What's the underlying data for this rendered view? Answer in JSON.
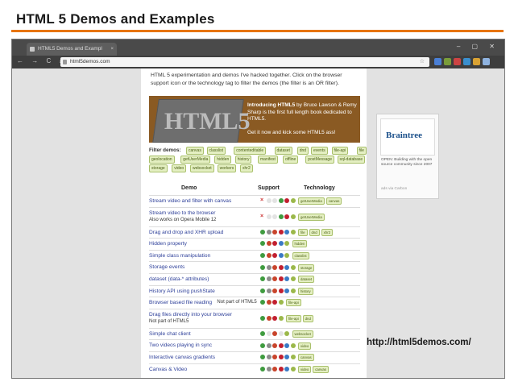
{
  "slide": {
    "title": "HTML 5 Demos and Examples",
    "caption": "http://html5demos.com/"
  },
  "browser": {
    "tab_title": "HTML5 Demos and Exampl",
    "tab_close": "×",
    "window_controls": "– ▢ ✕",
    "nav_icons": "← → C ⌂",
    "url": "html5demos.com",
    "omnibox_icons": "☆",
    "extension_colors": [
      "#4a7fd6",
      "#7a9c3a",
      "#cc4444",
      "#3a8fcf",
      "#d9a233",
      "#8fb3e0"
    ]
  },
  "page": {
    "intro": "HTML 5 experimentation and demos I've hacked together. Click on the browser support icon or the technology tag to filter the demos (the filter is an OR filter).",
    "banner": {
      "image_text": "HTML5",
      "pre": "Introducing HTML5",
      "post": " by Bruce Lawson & Remy Sharp is the first full length book dedicated to HTML5.",
      "cta": "Get it now and kick some HTML5 ass!"
    },
    "filter_label": "Filter demos:",
    "filter_tags": [
      "canvas",
      "classlist",
      "contenteditable",
      "dataset",
      "dnd",
      "events",
      "file-api",
      "file",
      "geolocation",
      "getUserMedia",
      "hidden",
      "history",
      "manifest",
      "offline",
      "postMessage",
      "sql-database",
      "storage",
      "video",
      "websocket",
      "workers",
      "xhr2"
    ],
    "table_headers": {
      "demo": "Demo",
      "support": "Support",
      "technology": "Technology"
    },
    "rows": [
      {
        "title": "Stream video and filter with canvas",
        "note": "",
        "support": [
          "x",
          "n",
          "n",
          "g",
          "r",
          "c"
        ],
        "tech": [
          "getUserMedia",
          "canvas"
        ]
      },
      {
        "title": "Stream video to the browser",
        "note": "Also works on Opera Mobile 12",
        "support": [
          "x",
          "n",
          "n",
          "g",
          "r",
          "c"
        ],
        "tech": [
          "getUserMedia"
        ]
      },
      {
        "title": "Drag and drop and XHR upload",
        "note": "",
        "support": [
          "g",
          "s",
          "f",
          "r",
          "o",
          "c"
        ],
        "tech": [
          "file",
          "dnd",
          "xhr2"
        ]
      },
      {
        "title": "Hidden property",
        "note": "",
        "support": [
          "g",
          "f",
          "r",
          "o",
          "c"
        ],
        "tech": [
          "hidden"
        ]
      },
      {
        "title": "Simple class manipulation",
        "note": "",
        "support": [
          "g",
          "f",
          "r",
          "o",
          "c"
        ],
        "tech": [
          "classlist"
        ]
      },
      {
        "title": "Storage events",
        "note": "",
        "support": [
          "g",
          "s",
          "f",
          "r",
          "o",
          "c"
        ],
        "tech": [
          "storage"
        ]
      },
      {
        "title": "dataset (data-* attributes)",
        "note": "",
        "support": [
          "g",
          "s",
          "f",
          "r",
          "o",
          "c"
        ],
        "tech": [
          "dataset"
        ]
      },
      {
        "title": "History API using pushState",
        "note": "",
        "support": [
          "g",
          "s",
          "f",
          "r",
          "o",
          "c"
        ],
        "tech": [
          "history"
        ]
      },
      {
        "title": "Browser based file reading",
        "note": "Not part of HTML5",
        "support": [
          "g",
          "f",
          "r",
          "c"
        ],
        "tech": [
          "file-api"
        ]
      },
      {
        "title": "Drag files directly into your browser",
        "note": "Not part of HTML5",
        "support": [
          "g",
          "f",
          "r",
          "c"
        ],
        "tech": [
          "file-api",
          "dnd"
        ]
      },
      {
        "title": "Simple chat client",
        "note": "",
        "support": [
          "g",
          "n",
          "f",
          "n",
          "c"
        ],
        "tech": [
          "websocket"
        ]
      },
      {
        "title": "Two videos playing in sync",
        "note": "",
        "support": [
          "g",
          "s",
          "f",
          "r",
          "o",
          "c"
        ],
        "tech": [
          "video"
        ]
      },
      {
        "title": "Interactive canvas gradients",
        "note": "",
        "support": [
          "g",
          "s",
          "f",
          "r",
          "o",
          "c"
        ],
        "tech": [
          "canvas"
        ]
      },
      {
        "title": "Canvas & Video",
        "note": "",
        "support": [
          "g",
          "s",
          "f",
          "r",
          "o",
          "c"
        ],
        "tech": [
          "video",
          "canvas"
        ]
      }
    ]
  },
  "ad": {
    "logo": "Braintree",
    "text": "OPEN: Building with the open source community since 2007",
    "by": "ads via Carbon"
  },
  "colors": {
    "accent_rule": "#e8750f",
    "banner_bg": "#8a5a23",
    "link": "#2d3f99",
    "support": {
      "g": "#3f9b3f",
      "s": "#8c8c8c",
      "f": "#c8442b",
      "r": "#c21f2f",
      "o": "#3a7ac4",
      "c": "#9bb84a",
      "n": "#e3e3e3",
      "x": "#c33"
    }
  }
}
